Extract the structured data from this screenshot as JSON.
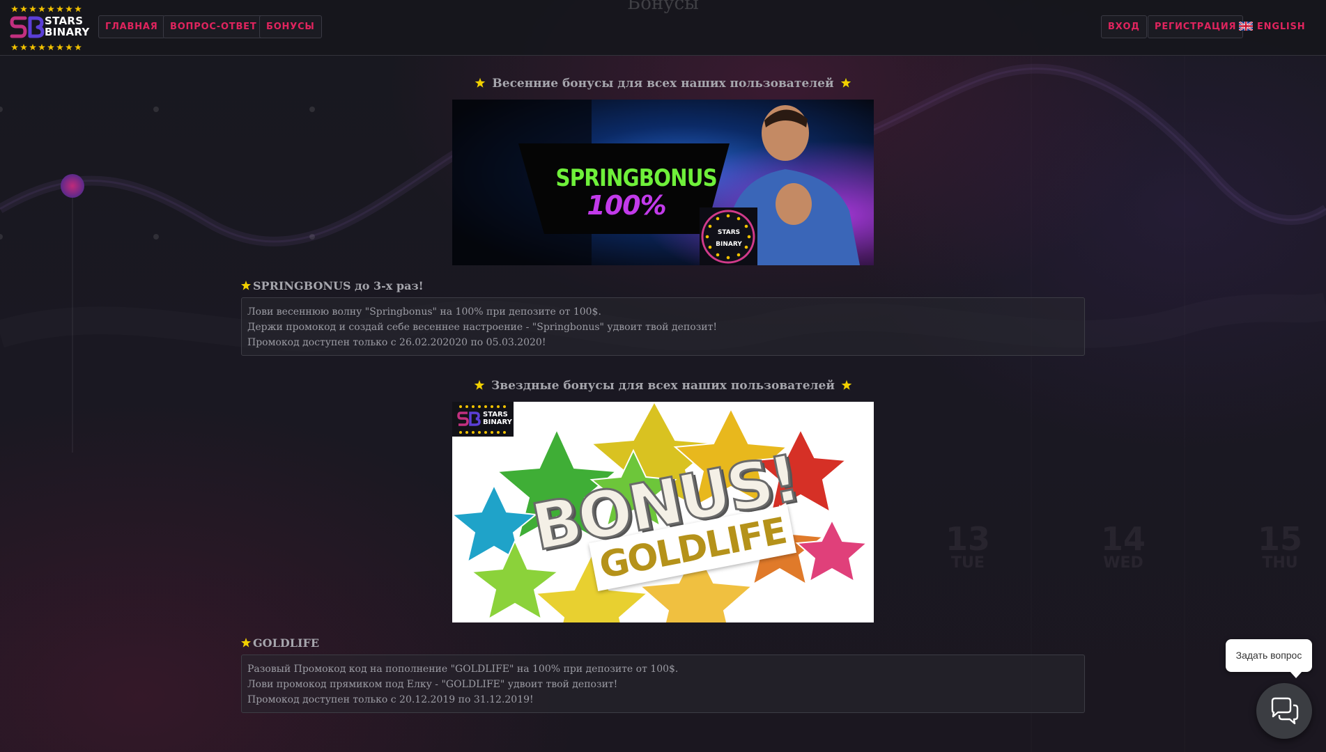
{
  "page": {
    "ghost_title": "Бонусы"
  },
  "header": {
    "logo": {
      "line1": "STARS",
      "line2": "BINARY",
      "monogram": "SB"
    },
    "nav": [
      {
        "label": "ГЛАВНАЯ"
      },
      {
        "label": "ВОПРОС-ОТВЕТ"
      },
      {
        "label": "БОНУСЫ"
      }
    ],
    "login_label": "ВХОД",
    "register_label": "РЕГИСТРАЦИЯ",
    "language": {
      "label": "ENGLISH",
      "flag": "uk-flag-icon"
    }
  },
  "sections": [
    {
      "title": "Весенние бонусы для всех наших пользователей",
      "banner": {
        "line1": "SPRINGBONUS",
        "line2": "100%",
        "badge_top": "STARS",
        "badge_bottom": "BINARY"
      },
      "promo_name": "SPRINGBONUS до 3-х раз!",
      "lines": [
        "Лови весеннюю волну \"Springbonus\" на 100% при депозите от 100$.",
        "Держи промокод и создай себе весеннее настроение - \"Springbonus\" удвоит твой депозит!",
        "Промокод доступен только с 26.02.202020 по 05.03.2020!"
      ]
    },
    {
      "title": "Звездные бонусы для всех наших пользователей",
      "banner": {
        "line1": "BONUS!",
        "line2": "GOLDLIFE",
        "badge_top": "STARS",
        "badge_bottom": "BINARY"
      },
      "promo_name": "GOLDLIFE",
      "lines": [
        "Разовый Промокод код на пополнение \"GOLDLIFE\" на 100% при депозите от 100$.",
        "Лови промокод прямиком под Елку - \"GOLDLIFE\" удвоит твой депозит!",
        "Промокод доступен только с 20.12.2019 по 31.12.2019!"
      ]
    }
  ],
  "background_dates": [
    {
      "num": "13",
      "day": "TUE"
    },
    {
      "num": "14",
      "day": "WED"
    },
    {
      "num": "15",
      "day": "THU"
    }
  ],
  "chat": {
    "tooltip": "Задать вопрос",
    "icon": "chat-bubbles-icon"
  },
  "colors": {
    "accent": "#e0245e",
    "star": "#f2c200",
    "background": "#17171d"
  }
}
